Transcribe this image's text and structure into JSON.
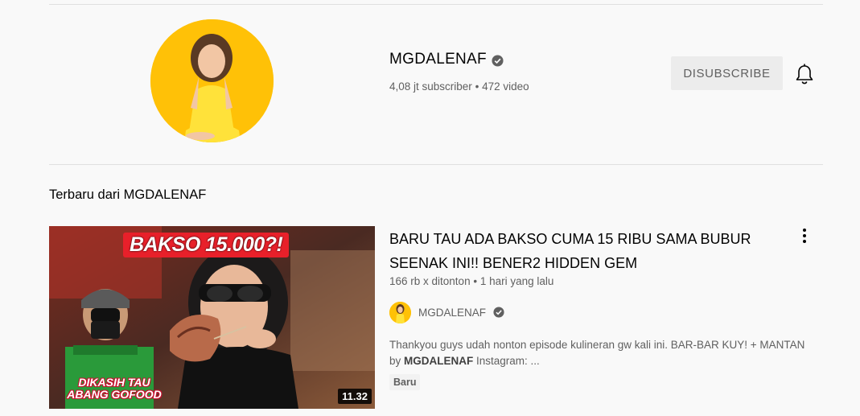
{
  "channel": {
    "name": "MGDALENAF",
    "subscribers": "4,08 jt subscriber",
    "separator": "•",
    "videos": "472 video",
    "unsubscribe_label": "DISUBSCRIBE"
  },
  "section": {
    "title": "Terbaru dari MGDALENAF"
  },
  "video": {
    "title": "BARU TAU ADA BAKSO CUMA 15 RIBU SAMA BUBUR SEENAK INI!! BENER2 HIDDEN GEM",
    "views": "166 rb x ditonton",
    "separator": "•",
    "age": "1 hari yang lalu",
    "uploader": "MGDALENAF",
    "description_lead": "Thankyou guys udah nonton episode kulineran gw kali ini. BAR-BAR KUY! + MANTAN by ",
    "description_bold": "MGDALENAF",
    "description_tail": " Instagram: ...",
    "badge": "Baru",
    "duration": "11.32",
    "thumbnail_headline": "BAKSO 15.000?!",
    "thumbnail_sub_line1": "DIKASIH TAU",
    "thumbnail_sub_line2": "ABANG GOFOOD"
  },
  "icons": {
    "verified": "verified-check-icon",
    "bell": "bell-icon",
    "more": "more-vert-icon"
  },
  "colors": {
    "background": "#f9f9f9",
    "avatar_bg": "#ffc107",
    "button_bg": "#ececec",
    "secondary_text": "#606060",
    "thumbnail_headline_bg": "#e8202a"
  }
}
